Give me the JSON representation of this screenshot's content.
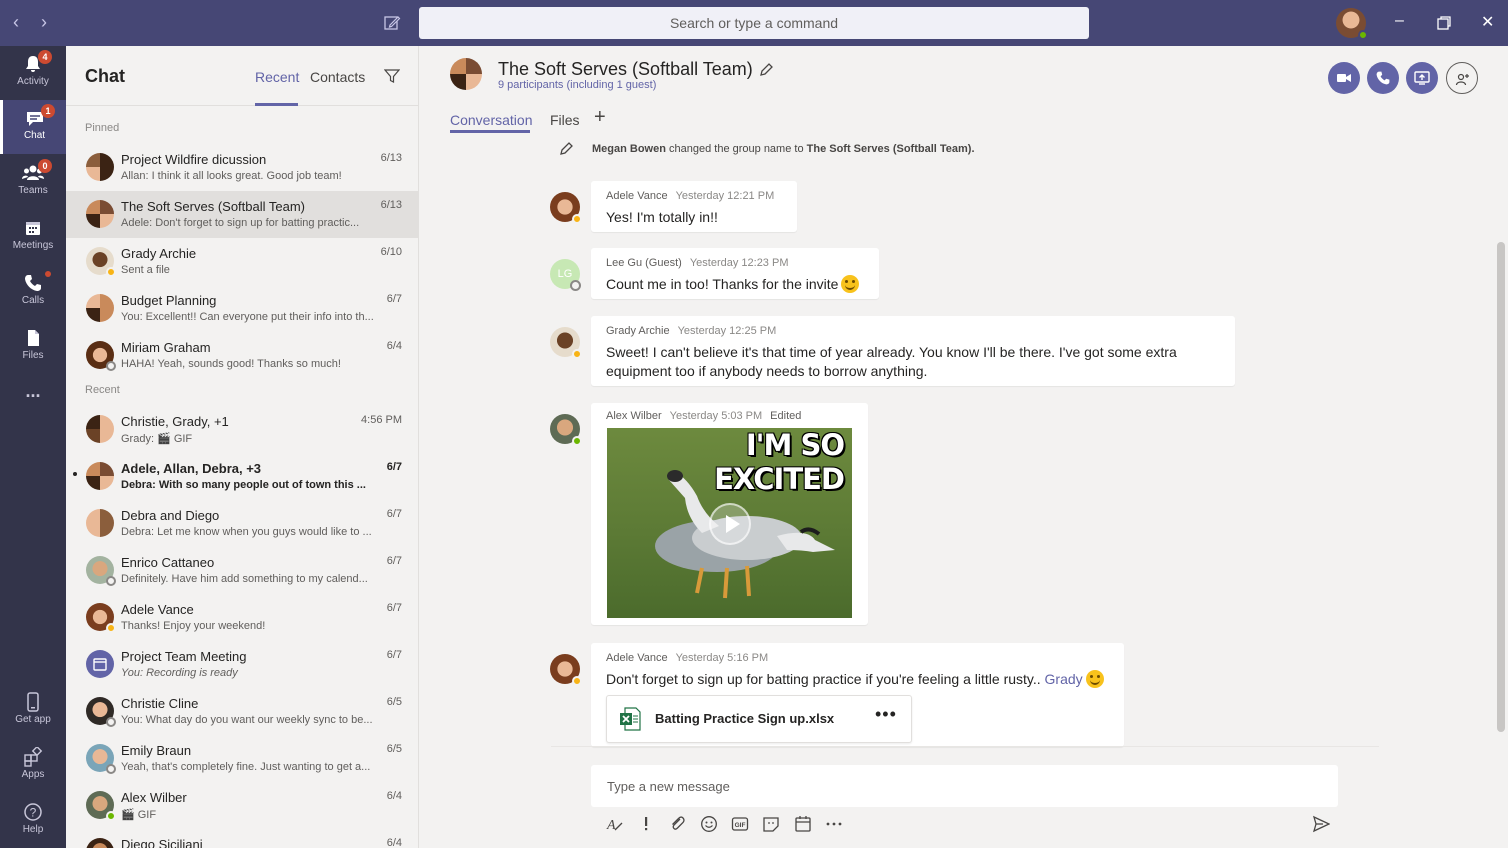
{
  "app": {
    "search_placeholder": "Search or type a command",
    "colors": {
      "titlebar": "#464775",
      "rail": "#33344a",
      "accent": "#6264a7",
      "badge": "#cc4a31",
      "available": "#6bb700",
      "away": "#f8b416"
    }
  },
  "rail": {
    "items": [
      {
        "label": "Activity",
        "icon": "bell-icon",
        "badge": "4"
      },
      {
        "label": "Chat",
        "icon": "chat-icon",
        "badge": "1",
        "active": true
      },
      {
        "label": "Teams",
        "icon": "teams-icon",
        "badge": "0"
      },
      {
        "label": "Meetings",
        "icon": "calendar-icon"
      },
      {
        "label": "Calls",
        "icon": "phone-icon",
        "dot": true
      },
      {
        "label": "Files",
        "icon": "files-icon"
      },
      {
        "label": "...",
        "icon": "more-icon"
      }
    ],
    "bottom": [
      {
        "label": "Get app",
        "icon": "mobile-icon"
      },
      {
        "label": "Apps",
        "icon": "apps-icon"
      },
      {
        "label": "Help",
        "icon": "help-icon"
      }
    ]
  },
  "chatlist": {
    "title": "Chat",
    "tabs": [
      "Recent",
      "Contacts"
    ],
    "pinned_label": "Pinned",
    "recent_label": "Recent",
    "pinned": [
      {
        "name": "Project Wildfire dicussion",
        "preview": "Allan: I think it all looks great. Good job team!",
        "date": "6/13"
      },
      {
        "name": "The Soft Serves (Softball Team)",
        "preview": "Adele: Don't forget to sign up for batting practic...",
        "date": "6/13",
        "selected": true
      },
      {
        "name": "Grady Archie",
        "preview": "Sent a file",
        "date": "6/10"
      },
      {
        "name": "Budget Planning",
        "preview": "You: Excellent!! Can everyone put their info into th...",
        "date": "6/7"
      },
      {
        "name": "Miriam Graham",
        "preview": "HAHA! Yeah, sounds good! Thanks so much!",
        "date": "6/4"
      }
    ],
    "recent": [
      {
        "name": "Christie, Grady, +1",
        "preview": "Grady: 🎬 GIF",
        "date": "4:56 PM"
      },
      {
        "name": "Adele, Allan, Debra, +3",
        "preview": "Debra: With so many people out of town this ...",
        "date": "6/7",
        "unread": true
      },
      {
        "name": "Debra and Diego",
        "preview": "Debra: Let me know when you guys would like to ...",
        "date": "6/7"
      },
      {
        "name": "Enrico Cattaneo",
        "preview": "Definitely. Have him add something to my calend...",
        "date": "6/7"
      },
      {
        "name": "Adele Vance",
        "preview": "Thanks! Enjoy your weekend!",
        "date": "6/7"
      },
      {
        "name": "Project Team Meeting",
        "preview": "You: Recording is ready",
        "date": "6/7"
      },
      {
        "name": "Christie Cline",
        "preview": "You: What day do you want our weekly sync to be...",
        "date": "6/5"
      },
      {
        "name": "Emily Braun",
        "preview": "Yeah, that's completely fine. Just wanting to get a...",
        "date": "6/5"
      },
      {
        "name": "Alex Wilber",
        "preview": "🎬 GIF",
        "date": "6/4"
      },
      {
        "name": "Diego Siciliani",
        "preview": "",
        "date": "6/4"
      }
    ]
  },
  "conversation": {
    "title": "The Soft Serves (Softball Team)",
    "subtitle": "9 participants (including 1 guest)",
    "tabs": [
      "Conversation",
      "Files"
    ],
    "add_tab": "+",
    "system_message": {
      "actor": "Megan Bowen",
      "text": "changed the group name to",
      "new_name": "The Soft Serves (Softball Team)."
    },
    "messages": [
      {
        "author": "Adele Vance",
        "time": "Yesterday 12:21 PM",
        "text": "Yes!  I'm totally in!!"
      },
      {
        "author": "Lee Gu (Guest)",
        "time": "Yesterday 12:23 PM",
        "text": "Count me in too!  Thanks for the invite",
        "initials": "LG"
      },
      {
        "author": "Grady Archie",
        "time": "Yesterday 12:25 PM",
        "text": "Sweet! I can't believe it's that time of year already.  You know I'll be there.  I've got some extra",
        "text2": "equipment too if anybody needs to borrow anything."
      },
      {
        "author": "Alex Wilber",
        "time": "Yesterday 5:03 PM",
        "edited": "Edited",
        "gif_caption": "I'M SO EXCITED"
      },
      {
        "author": "Adele Vance",
        "time": "Yesterday 5:16 PM",
        "text": "Don't forget to sign up for batting practice if you're feeling a little rusty..",
        "mention": "Grady",
        "attachment": "Batting Practice Sign up.xlsx",
        "attachment_more": "•••"
      }
    ],
    "compose_placeholder": "Type a new message"
  }
}
